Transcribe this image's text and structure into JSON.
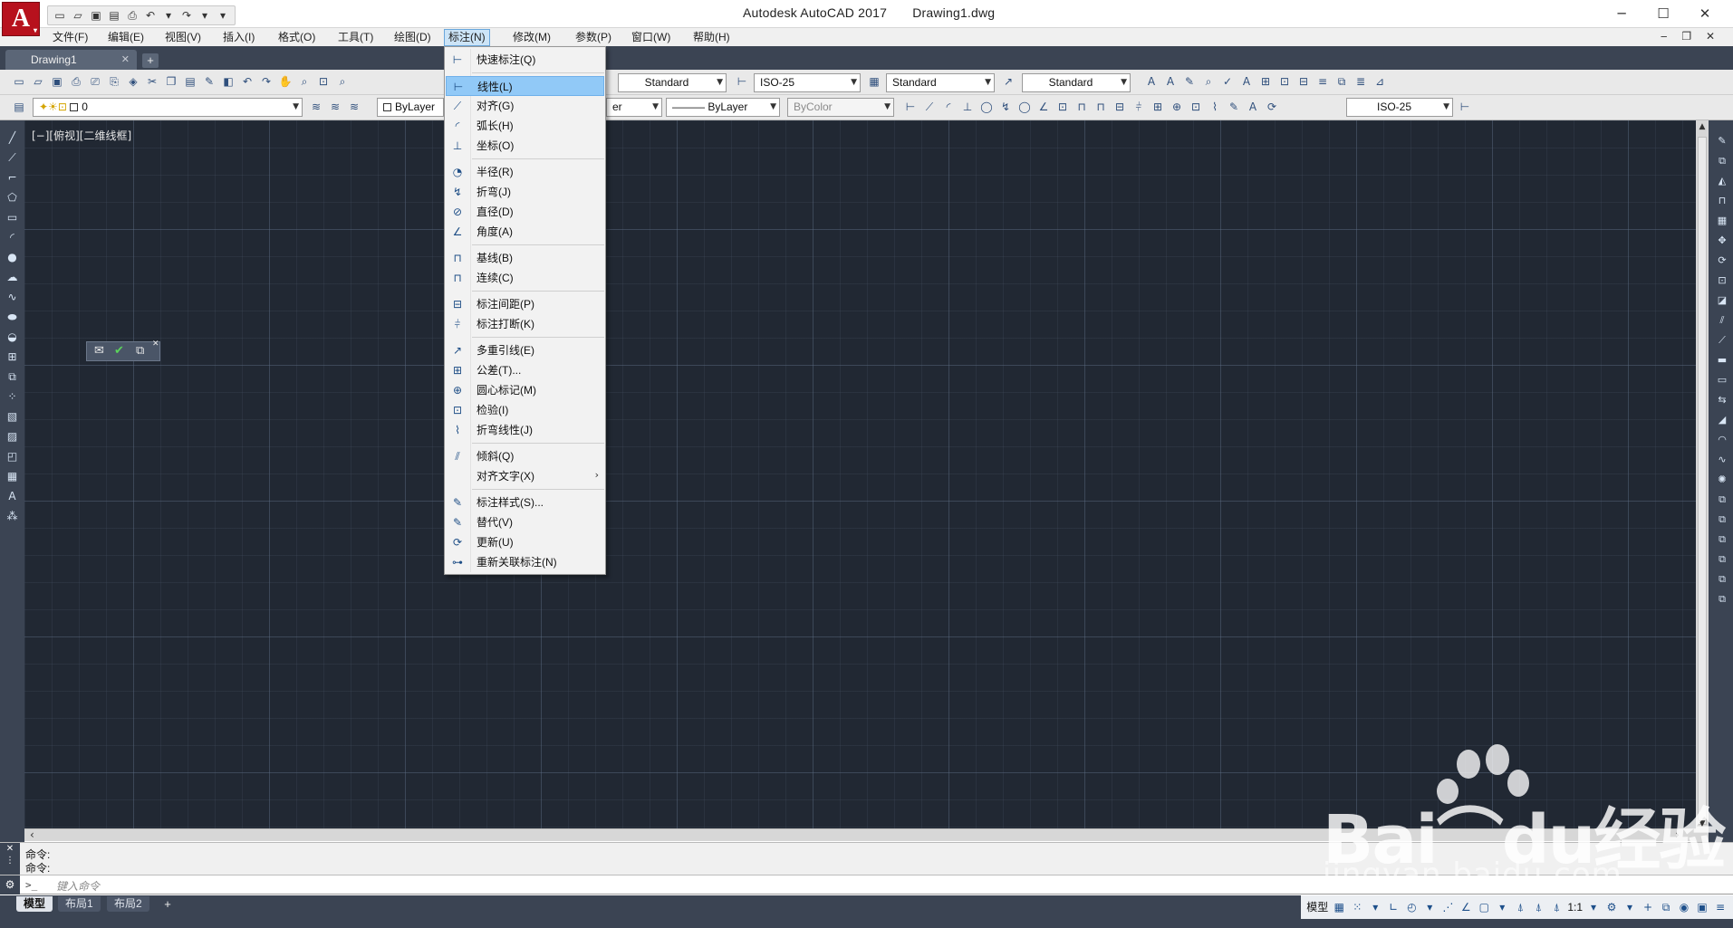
{
  "window": {
    "app_title": "Autodesk AutoCAD 2017",
    "file_title": "Drawing1.dwg",
    "minimize": "─",
    "maximize": "☐",
    "close": "✕"
  },
  "menubar": {
    "items": [
      {
        "label": "文件(F)"
      },
      {
        "label": "编辑(E)"
      },
      {
        "label": "视图(V)"
      },
      {
        "label": "插入(I)"
      },
      {
        "label": "格式(O)"
      },
      {
        "label": "工具(T)"
      },
      {
        "label": "绘图(D)"
      },
      {
        "label": "标注(N)",
        "active": true
      },
      {
        "label": "修改(M)"
      },
      {
        "label": "参数(P)"
      },
      {
        "label": "窗口(W)"
      },
      {
        "label": "帮助(H)"
      }
    ],
    "mdi_controls": "‒ ❐ ✕"
  },
  "tabs": {
    "document": "Drawing1",
    "close": "✕",
    "add": "+"
  },
  "toolbar": {
    "text_style": "Standard",
    "dim_style": "ISO-25",
    "table_style": "Standard",
    "mleader_style": "Standard",
    "layer": "0",
    "color": "ByLayer",
    "linetype_partial": "er",
    "lineweight": "——— ByLayer",
    "plot_style": "ByColor",
    "dim_style_2": "ISO-25"
  },
  "canvas": {
    "viewport_label": "[−][俯视][二维线框]",
    "background": "#212833"
  },
  "dimension_menu": {
    "items": [
      {
        "label": "快速标注(Q)",
        "icon": "quick-dimension-icon",
        "glyph": "⊢"
      },
      {
        "separator": true
      },
      {
        "label": "线性(L)",
        "icon": "linear-dimension-icon",
        "glyph": "⊢",
        "highlighted": true
      },
      {
        "label": "对齐(G)",
        "icon": "aligned-dimension-icon",
        "glyph": "⟋"
      },
      {
        "label": "弧长(H)",
        "icon": "arc-length-icon",
        "glyph": "◜"
      },
      {
        "label": "坐标(O)",
        "icon": "ordinate-icon",
        "glyph": "⊥"
      },
      {
        "separator": true
      },
      {
        "label": "半径(R)",
        "icon": "radius-icon",
        "glyph": "◔"
      },
      {
        "label": "折弯(J)",
        "icon": "jogged-icon",
        "glyph": "↯"
      },
      {
        "label": "直径(D)",
        "icon": "diameter-icon",
        "glyph": "⊘"
      },
      {
        "label": "角度(A)",
        "icon": "angular-icon",
        "glyph": "∠"
      },
      {
        "separator": true
      },
      {
        "label": "基线(B)",
        "icon": "baseline-icon",
        "glyph": "⊓"
      },
      {
        "label": "连续(C)",
        "icon": "continue-icon",
        "glyph": "⊓"
      },
      {
        "separator": true
      },
      {
        "label": "标注间距(P)",
        "icon": "dim-space-icon",
        "glyph": "⊟"
      },
      {
        "label": "标注打断(K)",
        "icon": "dim-break-icon",
        "glyph": "⫩"
      },
      {
        "separator": true
      },
      {
        "label": "多重引线(E)",
        "icon": "multileader-icon",
        "glyph": "↗"
      },
      {
        "label": "公差(T)...",
        "icon": "tolerance-icon",
        "glyph": "⊞"
      },
      {
        "label": "圆心标记(M)",
        "icon": "center-mark-icon",
        "glyph": "⊕"
      },
      {
        "label": "检验(I)",
        "icon": "inspection-icon",
        "glyph": "⊡"
      },
      {
        "label": "折弯线性(J)",
        "icon": "jogged-linear-icon",
        "glyph": "⌇"
      },
      {
        "separator": true
      },
      {
        "label": "倾斜(Q)",
        "icon": "oblique-icon",
        "glyph": "⫽"
      },
      {
        "label": "对齐文字(X)",
        "icon": "",
        "glyph": "",
        "submenu": true
      },
      {
        "separator": true
      },
      {
        "label": "标注样式(S)...",
        "icon": "dim-style-icon",
        "glyph": "✎"
      },
      {
        "label": "替代(V)",
        "icon": "override-icon",
        "glyph": "✎"
      },
      {
        "label": "更新(U)",
        "icon": "update-icon",
        "glyph": "⟳"
      },
      {
        "label": "重新关联标注(N)",
        "icon": "reassociate-icon",
        "glyph": "⊶"
      }
    ],
    "submenu_arrow": "›"
  },
  "command": {
    "history": [
      "命令:",
      "命令:"
    ],
    "prompt_icon": ">_",
    "placeholder": "键入命令"
  },
  "layouts": {
    "tabs": [
      {
        "label": "模型",
        "active": true
      },
      {
        "label": "布局1"
      },
      {
        "label": "布局2"
      }
    ],
    "add": "+"
  },
  "statusbar": {
    "model_label": "模型",
    "scale": "1:1"
  },
  "watermark": {
    "brand": "Bai⌒du经验",
    "url": "jingyan.baidu.com"
  }
}
